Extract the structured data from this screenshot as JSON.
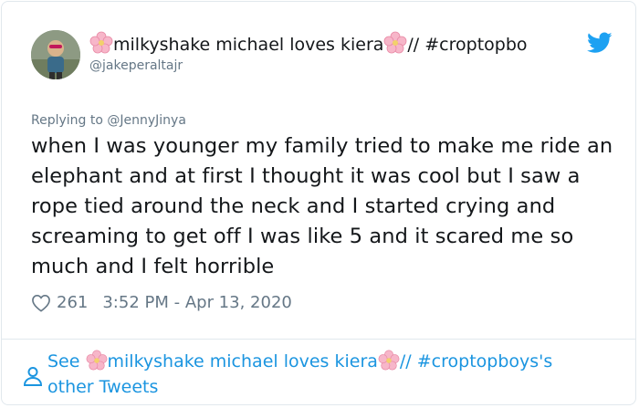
{
  "tweet": {
    "display_name_part1": "milkyshake michael loves kiera",
    "display_name_part2": "// #croptopbo",
    "handle": "@jakeperaltajr",
    "reply_prefix": "Replying to",
    "reply_mention": "@JennyJinya",
    "text": "when I was younger my family tried to make me ride an elephant and at first I thought it was cool but I saw a rope tied around the neck and I started crying and screaming to get off I was like 5 and it scared me so much and I felt horrible",
    "likes": "261",
    "timestamp": "3:52 PM - Apr 13, 2020"
  },
  "footer": {
    "see_label": "See",
    "name_part1": "milkyshake michael loves kiera",
    "name_part2": "// #croptopboys's",
    "suffix": "other Tweets"
  },
  "icons": {
    "flower": "cherry-blossom-icon",
    "brand": "twitter-bird-icon",
    "like": "heart-icon",
    "profile": "person-icon"
  },
  "colors": {
    "link": "#1b95e0",
    "muted": "#657786",
    "brand": "#1da1f2",
    "flower": "#f7b6c9"
  }
}
